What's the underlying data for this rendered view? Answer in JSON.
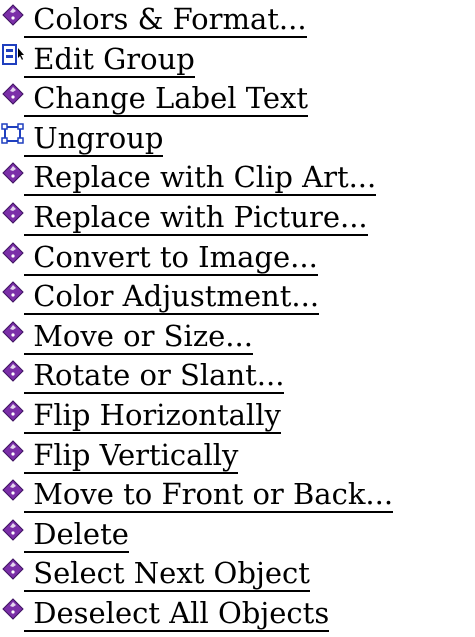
{
  "colors": {
    "text": "#000000",
    "diamond_fill": "#7b2fa8",
    "diamond_highlight": "#ffffff",
    "group_icon_blue": "#1f3fbf"
  },
  "menu": {
    "items": [
      {
        "label": "Colors & Format...",
        "icon": "diamond-bullet-icon"
      },
      {
        "label": "Edit Group",
        "icon": "edit-group-icon"
      },
      {
        "label": "Change Label Text",
        "icon": "diamond-bullet-icon"
      },
      {
        "label": "Ungroup",
        "icon": "ungroup-icon"
      },
      {
        "label": "Replace with Clip Art...",
        "icon": "diamond-bullet-icon"
      },
      {
        "label": "Replace with Picture...",
        "icon": "diamond-bullet-icon"
      },
      {
        "label": "Convert to Image...",
        "icon": "diamond-bullet-icon"
      },
      {
        "label": "Color Adjustment...",
        "icon": "diamond-bullet-icon"
      },
      {
        "label": "Move or Size...",
        "icon": "diamond-bullet-icon"
      },
      {
        "label": "Rotate or Slant...",
        "icon": "diamond-bullet-icon"
      },
      {
        "label": "Flip Horizontally",
        "icon": "diamond-bullet-icon"
      },
      {
        "label": "Flip Vertically",
        "icon": "diamond-bullet-icon"
      },
      {
        "label": "Move to Front or Back...",
        "icon": "diamond-bullet-icon"
      },
      {
        "label": "Delete",
        "icon": "diamond-bullet-icon"
      },
      {
        "label": "Select Next Object",
        "icon": "diamond-bullet-icon"
      },
      {
        "label": "Deselect All Objects",
        "icon": "diamond-bullet-icon"
      }
    ]
  }
}
